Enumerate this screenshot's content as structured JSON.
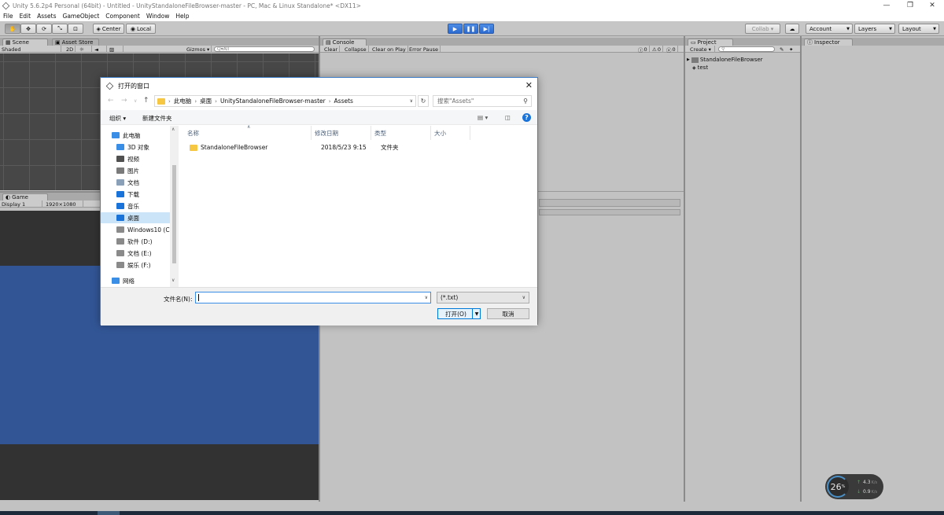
{
  "window": {
    "title": "Unity 5.6.2p4 Personal (64bit) - Untitled - UnityStandaloneFileBrowser-master - PC, Mac & Linux Standalone* <DX11>",
    "minimize_glyph": "—",
    "restore_glyph": "❐",
    "close_glyph": "✕"
  },
  "menu": [
    "File",
    "Edit",
    "Assets",
    "GameObject",
    "Component",
    "Window",
    "Help"
  ],
  "toolbar": {
    "pivot_label": "Center",
    "space_label": "Local",
    "collab_label": "Collab ▾",
    "account_label": "Account",
    "layers_label": "Layers",
    "layout_label": "Layout"
  },
  "scene_panel": {
    "tabs": [
      "Scene",
      "Asset Store"
    ],
    "shading": "Shaded",
    "mode_2d": "2D",
    "gizmos": "Gizmos ▾",
    "search_placeholder": "Q▾All"
  },
  "game_panel": {
    "tab": "Game",
    "display": "Display 1",
    "resolution": "1920×1080"
  },
  "console_panel": {
    "tab": "Console",
    "buttons": [
      "Clear",
      "Collapse",
      "Clear on Play",
      "Error Pause"
    ],
    "counts": [
      "0",
      "0",
      "0"
    ]
  },
  "project_panel": {
    "tab": "Project",
    "create_label": "Create ▾",
    "tree": [
      "StandaloneFileBrowser",
      "test"
    ]
  },
  "inspector_panel": {
    "tab": "Inspector"
  },
  "dialog": {
    "title": "打开的窗口",
    "breadcrumb": [
      "此电脑",
      "桌面",
      "UnityStandaloneFileBrowser-master",
      "Assets"
    ],
    "search_placeholder": "搜索\"Assets\"",
    "organize_label": "组织 ▾",
    "new_folder_label": "新建文件夹",
    "nav_items": [
      {
        "label": "此电脑",
        "color": "#3a8ee6"
      },
      {
        "label": "3D 对象",
        "color": "#3a8ee6"
      },
      {
        "label": "视频",
        "color": "#505050"
      },
      {
        "label": "图片",
        "color": "#7a7a7a"
      },
      {
        "label": "文档",
        "color": "#8aa0b8"
      },
      {
        "label": "下载",
        "color": "#1a73d9"
      },
      {
        "label": "音乐",
        "color": "#1a73d9"
      },
      {
        "label": "桌面",
        "color": "#1a73d9"
      },
      {
        "label": "Windows10 (C:)",
        "color": "#8a8a8a"
      },
      {
        "label": "软件 (D:)",
        "color": "#8a8a8a"
      },
      {
        "label": "文档 (E:)",
        "color": "#8a8a8a"
      },
      {
        "label": "娱乐 (F:)",
        "color": "#8a8a8a"
      },
      {
        "label": "网络",
        "color": "#3a8ee6"
      }
    ],
    "columns": [
      "名称",
      "修改日期",
      "类型",
      "大小"
    ],
    "files": [
      {
        "name": "StandaloneFileBrowser",
        "modified": "2018/5/23 9:15",
        "type": "文件夹",
        "size": ""
      }
    ],
    "filename_label": "文件名(N):",
    "filename_value": "",
    "filetype_value": "(*.txt)",
    "open_label": "打开(O)",
    "cancel_label": "取消"
  },
  "netmon": {
    "percent": "26",
    "percent_unit": "%",
    "up_rate": "4.3",
    "down_rate": "0.9",
    "rate_unit": "K/s"
  }
}
